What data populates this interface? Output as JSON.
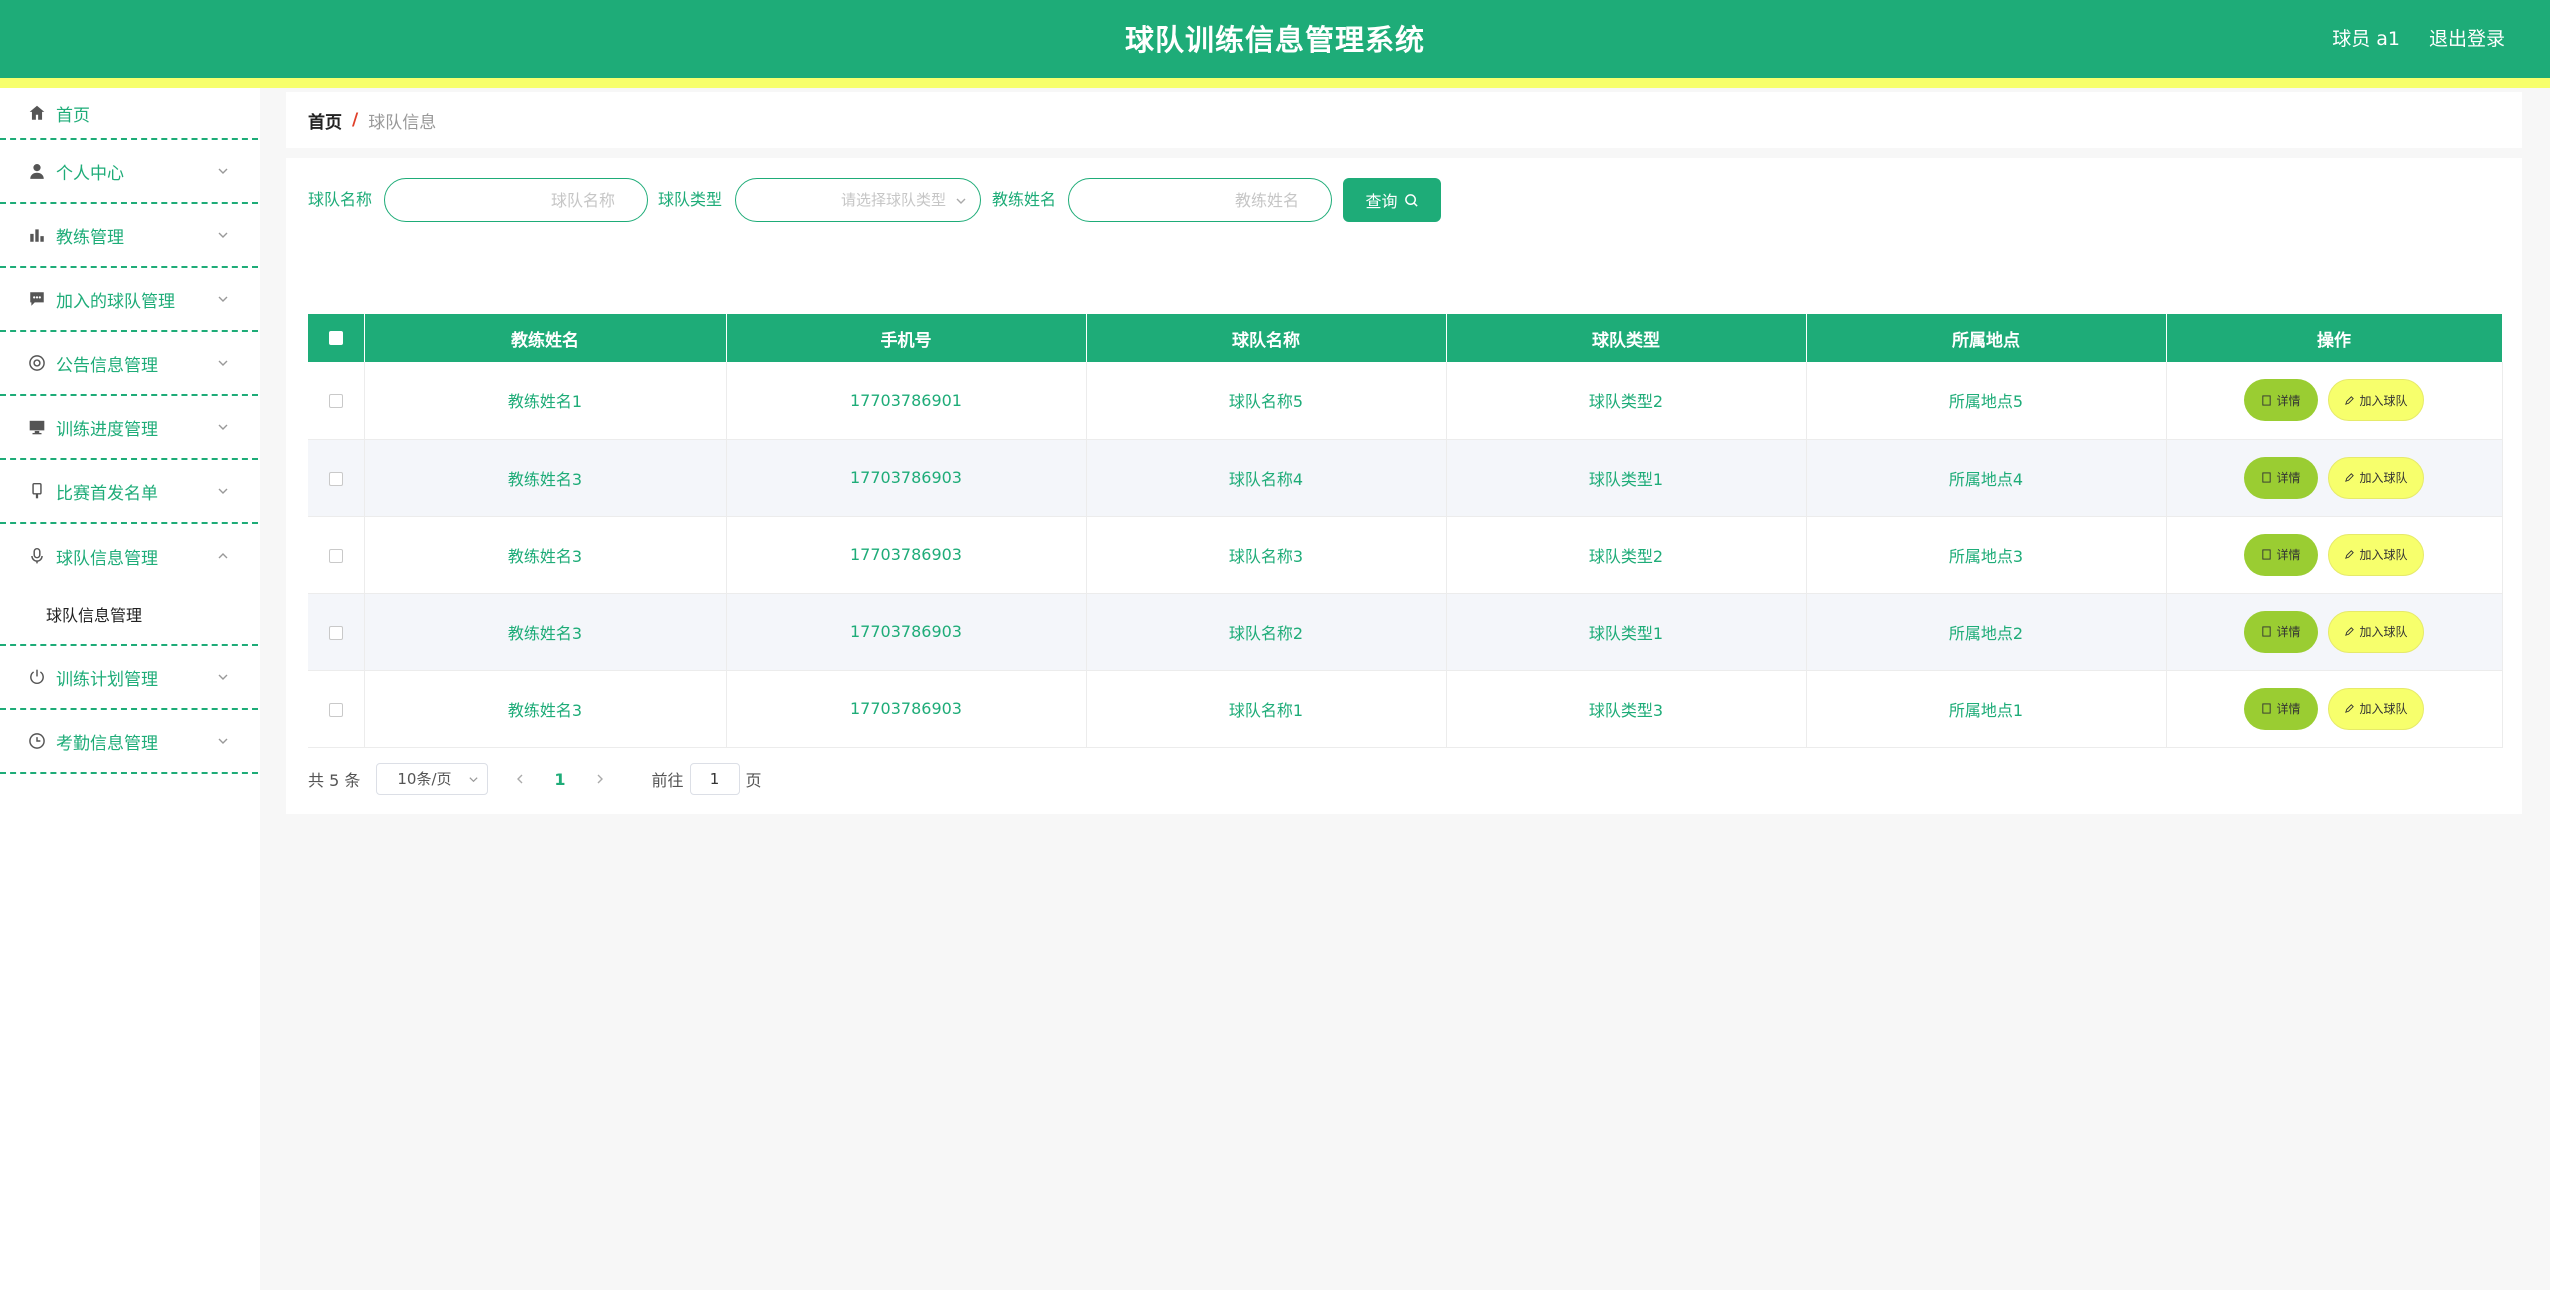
{
  "header": {
    "title": "球队训练信息管理系统",
    "user": "球员 a1",
    "logout": "退出登录"
  },
  "colors": {
    "primary": "#1eac78",
    "stripe": "#f7ff6c",
    "detail_button": "#9acd32",
    "join_button": "#f7ff6c"
  },
  "sidebar": {
    "items": [
      {
        "label": "首页",
        "icon": "home-icon"
      },
      {
        "label": "个人中心",
        "icon": "user-icon"
      },
      {
        "label": "教练管理",
        "icon": "bar-chart-icon"
      },
      {
        "label": "加入的球队管理",
        "icon": "chat-icon"
      },
      {
        "label": "公告信息管理",
        "icon": "at-icon"
      },
      {
        "label": "训练进度管理",
        "icon": "monitor-icon"
      },
      {
        "label": "比赛首发名单",
        "icon": "tag-icon"
      },
      {
        "label": "球队信息管理",
        "icon": "microphone-icon"
      },
      {
        "label": "训练计划管理",
        "icon": "power-icon"
      },
      {
        "label": "考勤信息管理",
        "icon": "clock-icon"
      }
    ],
    "submenu_label": "球队信息管理"
  },
  "breadcrumb": {
    "home": "首页",
    "separator": "/",
    "current": "球队信息"
  },
  "search": {
    "team_name_label": "球队名称",
    "team_name_placeholder": "球队名称",
    "team_type_label": "球队类型",
    "team_type_placeholder": "请选择球队类型",
    "coach_name_label": "教练姓名",
    "coach_name_placeholder": "教练姓名",
    "query_label": "查询"
  },
  "table": {
    "headers": [
      "教练姓名",
      "手机号",
      "球队名称",
      "球队类型",
      "所属地点",
      "操作"
    ],
    "rows": [
      {
        "coach": "教练姓名1",
        "phone": "17703786901",
        "team": "球队名称5",
        "type": "球队类型2",
        "location": "所属地点5"
      },
      {
        "coach": "教练姓名3",
        "phone": "17703786903",
        "team": "球队名称4",
        "type": "球队类型1",
        "location": "所属地点4"
      },
      {
        "coach": "教练姓名3",
        "phone": "17703786903",
        "team": "球队名称3",
        "type": "球队类型2",
        "location": "所属地点3"
      },
      {
        "coach": "教练姓名3",
        "phone": "17703786903",
        "team": "球队名称2",
        "type": "球队类型1",
        "location": "所属地点2"
      },
      {
        "coach": "教练姓名3",
        "phone": "17703786903",
        "team": "球队名称1",
        "type": "球队类型3",
        "location": "所属地点1"
      }
    ],
    "detail_label": "详情",
    "join_label": "加入球队"
  },
  "pagination": {
    "total": "共 5 条",
    "page_size": "10条/页",
    "current_page": "1",
    "goto_label": "前往",
    "goto_value": "1",
    "page_suffix": "页"
  }
}
